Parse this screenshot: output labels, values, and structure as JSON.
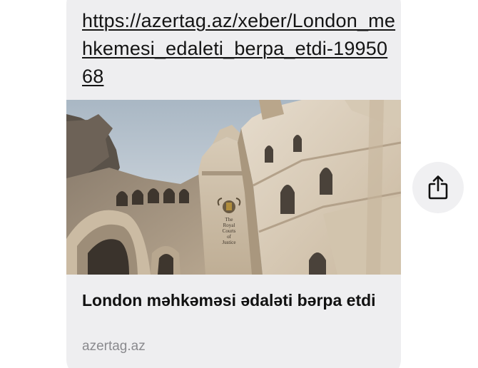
{
  "message_bubble": {
    "url_text": "https://azertag.az/xeber/London_mehkemesi_edaleti_berpa_etdi-1995068",
    "link_preview": {
      "title": "London məhkəməsi ədaləti bərpa etdi",
      "domain": "azertag.az",
      "image_sign_text": [
        "The",
        "Royal",
        "Courts",
        "of",
        "Justice"
      ]
    }
  },
  "share_button": {
    "icon": "share-icon"
  },
  "colors": {
    "bubble_background": "#eeeef0",
    "text": "#141414",
    "domain_text": "#8a8a8e",
    "share_button_background": "#f0f0f2"
  }
}
